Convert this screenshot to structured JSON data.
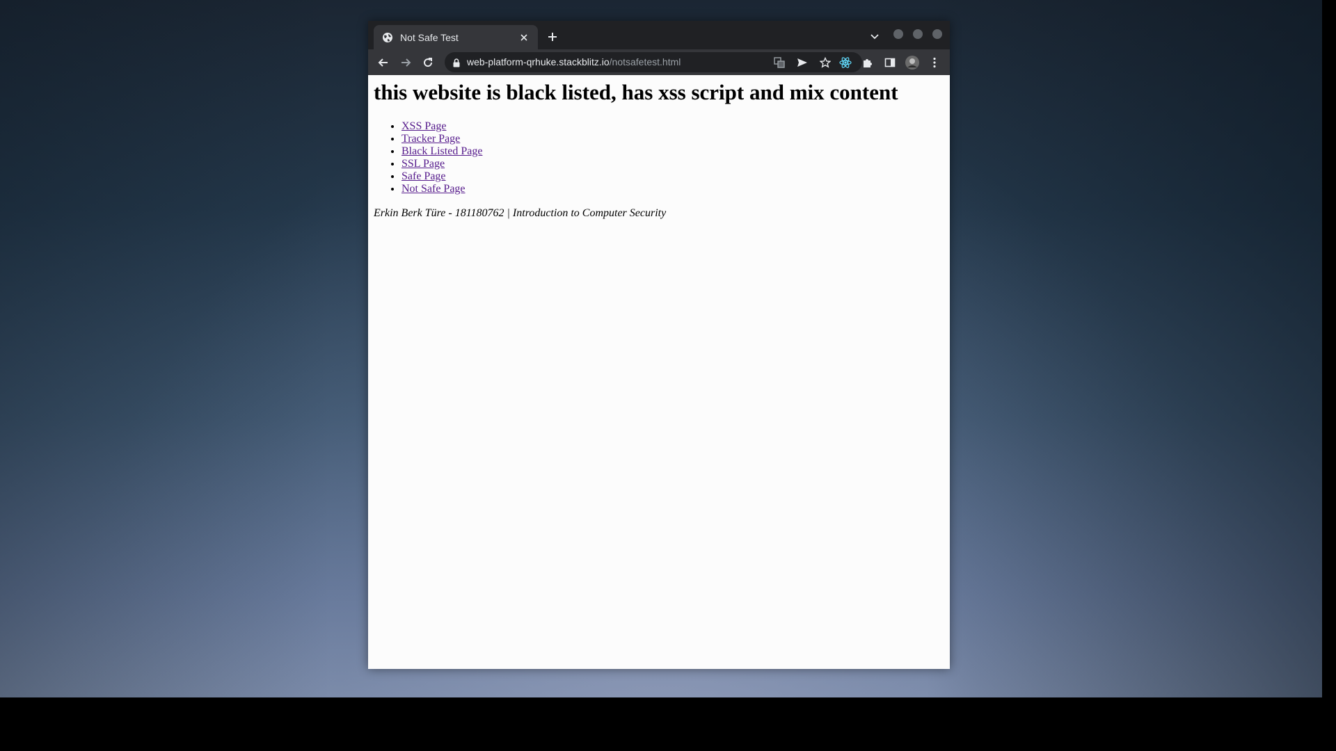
{
  "browser": {
    "tab": {
      "title": "Not Safe Test",
      "favicon_icon": "globe-icon"
    },
    "url": {
      "host": "web-platform-qrhuke.stackblitz.io",
      "path": "/notsafetest.html"
    },
    "icons": {
      "back": "arrow-left-icon",
      "forward": "arrow-right-icon",
      "reload": "reload-icon",
      "lock": "lock-icon",
      "translate": "translate-icon",
      "send": "send-icon",
      "bookmark": "star-icon",
      "react_devtools": "react-icon",
      "extensions": "puzzle-icon",
      "side_panel": "side-panel-icon",
      "profile": "avatar",
      "menu": "kebab-menu-icon"
    },
    "colors": {
      "frame": "#202124",
      "toolbar": "#35363a",
      "link_visited": "#551a8b"
    }
  },
  "page": {
    "heading": "this website is black listed, has xss script and mix content",
    "links": [
      {
        "label": "XSS Page"
      },
      {
        "label": "Tracker Page"
      },
      {
        "label": "Black Listed Page"
      },
      {
        "label": "SSL Page"
      },
      {
        "label": "Safe Page"
      },
      {
        "label": "Not Safe Page"
      }
    ],
    "footer": "Erkin Berk Türe - 181180762 | Introduction to Computer Security"
  }
}
